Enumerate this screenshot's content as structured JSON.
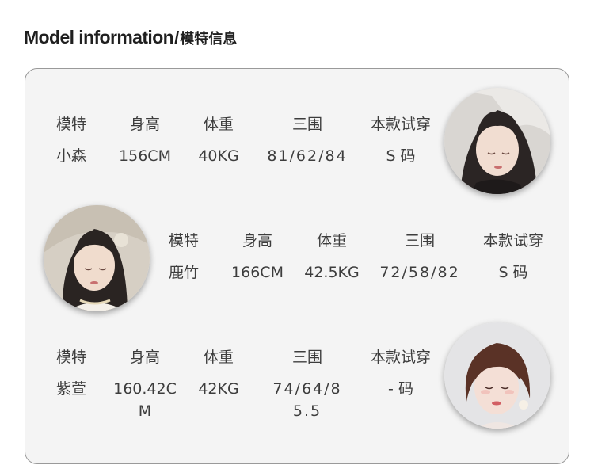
{
  "title": {
    "en": "Model information",
    "sep": "/",
    "cn": "模特信息"
  },
  "headers": [
    "模特",
    "身高",
    "体重",
    "三围",
    "本款试穿"
  ],
  "models": [
    {
      "name": "小森",
      "height": "156CM",
      "weight": "40KG",
      "measurements": "81/62/84",
      "size": "S 码"
    },
    {
      "name": "鹿竹",
      "height": "166CM",
      "weight": "42.5KG",
      "measurements": "72/58/82",
      "size": "S 码"
    },
    {
      "name": "紫萱",
      "height": "160.42CM",
      "weight": "42KG",
      "measurements": "74/64/85.5",
      "size": "- 码"
    }
  ],
  "colors": {
    "panel_bg": "#f4f4f4",
    "panel_border": "#9a9a9a",
    "text": "#3d3d3d",
    "title": "#1f1f1f"
  }
}
